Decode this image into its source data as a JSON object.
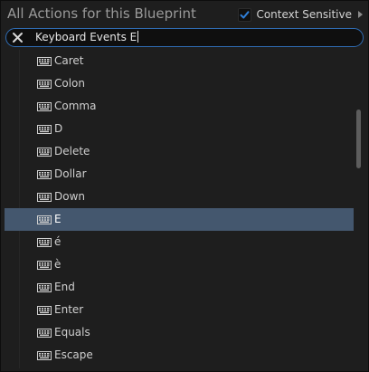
{
  "header": {
    "title": "All Actions for this Blueprint",
    "context_sensitive_label": "Context Sensitive",
    "context_sensitive_checked": true
  },
  "search": {
    "value": "Keyboard Events E"
  },
  "items": [
    {
      "label": "Caret",
      "icon": "keyboard-icon"
    },
    {
      "label": "Colon",
      "icon": "keyboard-icon"
    },
    {
      "label": "Comma",
      "icon": "keyboard-icon"
    },
    {
      "label": "D",
      "icon": "keyboard-icon"
    },
    {
      "label": "Delete",
      "icon": "keyboard-icon"
    },
    {
      "label": "Dollar",
      "icon": "keyboard-icon"
    },
    {
      "label": "Down",
      "icon": "keyboard-icon"
    },
    {
      "label": "E",
      "icon": "keyboard-icon",
      "selected": true
    },
    {
      "label": "é",
      "icon": "keyboard-icon"
    },
    {
      "label": "è",
      "icon": "keyboard-icon"
    },
    {
      "label": "End",
      "icon": "keyboard-icon"
    },
    {
      "label": "Enter",
      "icon": "keyboard-icon"
    },
    {
      "label": "Equals",
      "icon": "keyboard-icon"
    },
    {
      "label": "Escape",
      "icon": "keyboard-icon"
    }
  ],
  "colors": {
    "selection": "#44576e",
    "search_border": "#2f6cb3",
    "checkbox_check": "#2f7fd8"
  }
}
